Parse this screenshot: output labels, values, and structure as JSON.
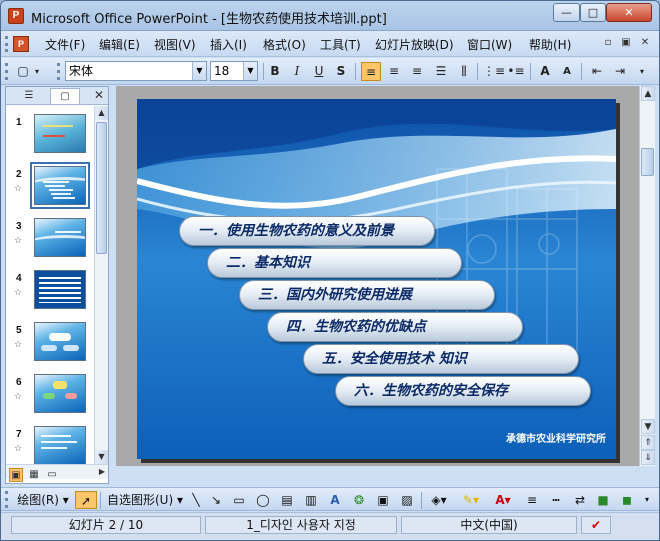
{
  "window": {
    "title": "Microsoft Office PowerPoint - [生物农药使用技术培训.ppt]",
    "app_icon": "powerpoint-icon",
    "min_label": "—",
    "max_label": "□",
    "close_label": "✕"
  },
  "menu": {
    "items": [
      "文件(F)",
      "编辑(E)",
      "视图(V)",
      "插入(I)",
      "格式(O)",
      "工具(T)",
      "幻灯片放映(D)",
      "窗口(W)",
      "帮助(H)"
    ]
  },
  "toolbar": {
    "font_name": "宋体",
    "font_size": "18",
    "bold": "B",
    "italic": "I",
    "underline": "U",
    "shadow": "S",
    "grow_font": "A",
    "shrink_font": "A"
  },
  "pane": {
    "tab_outline_icon": "outline-icon",
    "tab_slides_icon": "slides-icon",
    "close_label": "✕",
    "slides": [
      {
        "num": "1"
      },
      {
        "num": "2"
      },
      {
        "num": "3"
      },
      {
        "num": "4"
      },
      {
        "num": "5"
      },
      {
        "num": "6"
      },
      {
        "num": "7"
      }
    ]
  },
  "slide": {
    "items": [
      "一．使用生物农药的意义及前景",
      "二．基本知识",
      "三．国内外研究使用进展",
      "四．生物农药的优缺点",
      "五．安全使用技术 知识",
      "六．生物农药的安全保存"
    ],
    "footer": "承德市农业科学研究所",
    "colors": {
      "background": "#1a6fc8",
      "pill_text": "#0b2a66"
    }
  },
  "drawing_toolbar": {
    "draw_label": "绘图(R)",
    "autoshapes_label": "自选图形(U)"
  },
  "status": {
    "slide_info": "幻灯片 2 / 10",
    "design": "1_디자인 사용자 지정",
    "language": "中文(中国)"
  }
}
